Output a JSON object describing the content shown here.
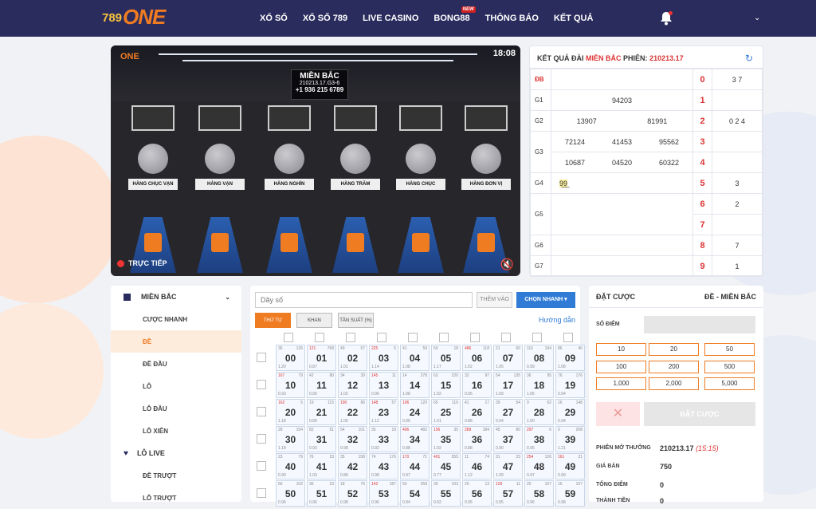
{
  "nav": {
    "logo_num": "789",
    "logo_text": "ONE",
    "items": [
      "XỔ SỐ",
      "XỔ SỐ 789",
      "LIVE CASINO",
      "BONG88",
      "THÔNG BÁO",
      "KẾT QUẢ"
    ],
    "new_badge": "NEW"
  },
  "video": {
    "logo": "ONE",
    "time": "18:08",
    "board_title": "MIỀN BẮC",
    "board_code": "210213.17.G3-6",
    "board_phone": "+1 936 215 6789",
    "signs": [
      "HÀNG CHỤC VẠN",
      "HÀNG VẠN",
      "HÀNG NGHÌN",
      "HÀNG TRĂM",
      "HÀNG CHỤC",
      "HÀNG ĐƠN VỊ"
    ],
    "live_label": "TRỰC TIẾP"
  },
  "results": {
    "title_prefix": "KẾT QUẢ ĐÀI",
    "region": "MIỀN BẮC",
    "session_label": "PHIÊN:",
    "session": "210213.17",
    "rows": [
      {
        "label": "ĐB",
        "nums": []
      },
      {
        "label": "G1",
        "nums": [
          "94203"
        ]
      },
      {
        "label": "G2",
        "nums": [
          "13907",
          "81991"
        ]
      },
      {
        "label": "G3",
        "nums": [
          "72124",
          "41453",
          "95562"
        ],
        "nums2": [
          "10687",
          "04520",
          "60322"
        ]
      },
      {
        "label": "G4",
        "nums": [
          "9̲9̲"
        ]
      },
      {
        "label": "G5",
        "nums": []
      },
      {
        "label": "G6",
        "nums": []
      },
      {
        "label": "G7",
        "nums": []
      }
    ],
    "heads": [
      "0",
      "1",
      "2",
      "3",
      "4",
      "5",
      "6",
      "7",
      "8",
      "9"
    ],
    "tails": [
      "3 7",
      "",
      "0 2 4",
      "",
      "",
      "3",
      "2",
      "",
      "7",
      "1"
    ]
  },
  "sidebar": {
    "group": "MIỀN BẮC",
    "items": [
      "CƯỢC NHANH",
      "ĐỀ",
      "ĐỀ ĐẦU",
      "LÔ",
      "LÔ ĐẦU",
      "LÔ XIÊN"
    ],
    "live_group": "LÔ LIVE",
    "live_items": [
      "ĐỀ TRƯỢT",
      "LÔ TRƯỢT"
    ]
  },
  "grid": {
    "search_placeholder": "Dãy số",
    "add_label": "THÊM VÀO",
    "quick_label": "CHỌN NHANH",
    "tabs": [
      "THỨ TỰ",
      "KHAN",
      "TẦN SUẤT (%)"
    ],
    "guide": "Hướng dẫn",
    "cells": [
      {
        "n": "00",
        "a": "36",
        "b": "126",
        "c": "1.20",
        "r": false
      },
      {
        "n": "01",
        "a": "121",
        "b": "768",
        "c": "0.87",
        "r": true
      },
      {
        "n": "02",
        "a": "49",
        "b": "57",
        "c": "1.01",
        "r": false
      },
      {
        "n": "03",
        "a": "225",
        "b": "5",
        "c": "1.14",
        "r": true
      },
      {
        "n": "04",
        "a": "41",
        "b": "59",
        "c": "1.08",
        "r": false
      },
      {
        "n": "05",
        "a": "59",
        "b": "18",
        "c": "1.17",
        "r": false
      },
      {
        "n": "06",
        "a": "486",
        "b": "118",
        "c": "1.02",
        "r": true
      },
      {
        "n": "07",
        "a": "21",
        "b": "60",
        "c": "1.05",
        "r": false
      },
      {
        "n": "08",
        "a": "116",
        "b": "194",
        "c": "0.99",
        "r": false
      },
      {
        "n": "09",
        "a": "86",
        "b": "40",
        "c": "1.08",
        "r": false
      },
      {
        "n": "10",
        "a": "167",
        "b": "79",
        "c": "0.93",
        "r": true
      },
      {
        "n": "11",
        "a": "42",
        "b": "80",
        "c": "0.90",
        "r": false
      },
      {
        "n": "12",
        "a": "34",
        "b": "39",
        "c": "1.02",
        "r": false
      },
      {
        "n": "13",
        "a": "145",
        "b": "11",
        "c": "0.96",
        "r": true
      },
      {
        "n": "14",
        "a": "14",
        "b": "278",
        "c": "1.08",
        "r": false
      },
      {
        "n": "15",
        "a": "63",
        "b": "220",
        "c": "1.02",
        "r": false
      },
      {
        "n": "16",
        "a": "32",
        "b": "97",
        "c": "0.95",
        "r": false
      },
      {
        "n": "17",
        "a": "54",
        "b": "135",
        "c": "1.09",
        "r": false
      },
      {
        "n": "18",
        "a": "36",
        "b": "95",
        "c": "1.05",
        "r": false
      },
      {
        "n": "19",
        "a": "76",
        "b": "176",
        "c": "0.94",
        "r": false
      },
      {
        "n": "20",
        "a": "162",
        "b": "5",
        "c": "1.18",
        "r": true
      },
      {
        "n": "21",
        "a": "19",
        "b": "115",
        "c": "0.89",
        "r": false
      },
      {
        "n": "22",
        "a": "190",
        "b": "86",
        "c": "1.05",
        "r": true
      },
      {
        "n": "23",
        "a": "148",
        "b": "57",
        "c": "1.12",
        "r": true
      },
      {
        "n": "24",
        "a": "106",
        "b": "120",
        "c": "0.96",
        "r": true
      },
      {
        "n": "25",
        "a": "65",
        "b": "116",
        "c": "1.01",
        "r": false
      },
      {
        "n": "26",
        "a": "41",
        "b": "17",
        "c": "0.88",
        "r": false
      },
      {
        "n": "27",
        "a": "39",
        "b": "54",
        "c": "0.94",
        "r": false
      },
      {
        "n": "28",
        "a": "9",
        "b": "62",
        "c": "1.00",
        "r": false
      },
      {
        "n": "29",
        "a": "16",
        "b": "148",
        "c": "0.94",
        "r": false
      },
      {
        "n": "30",
        "a": "28",
        "b": "154",
        "c": "1.18",
        "r": false
      },
      {
        "n": "31",
        "a": "82",
        "b": "51",
        "c": "0.93",
        "r": false
      },
      {
        "n": "32",
        "a": "54",
        "b": "101",
        "c": "0.98",
        "r": false
      },
      {
        "n": "33",
        "a": "35",
        "b": "10",
        "c": "0.92",
        "r": false
      },
      {
        "n": "34",
        "a": "406",
        "b": "482",
        "c": "0.98",
        "r": true
      },
      {
        "n": "35",
        "a": "156",
        "b": "35",
        "c": "1.02",
        "r": true
      },
      {
        "n": "36",
        "a": "289",
        "b": "184",
        "c": "0.88",
        "r": true
      },
      {
        "n": "37",
        "a": "45",
        "b": "80",
        "c": "0.90",
        "r": false
      },
      {
        "n": "38",
        "a": "297",
        "b": "6",
        "c": "0.95",
        "r": true
      },
      {
        "n": "39",
        "a": "0",
        "b": "208",
        "c": "1.21",
        "r": false
      },
      {
        "n": "40",
        "a": "23",
        "b": "79",
        "c": "0.90",
        "r": false
      },
      {
        "n": "41",
        "a": "76",
        "b": "23",
        "c": "1.03",
        "r": false
      },
      {
        "n": "42",
        "a": "35",
        "b": "158",
        "c": "0.86",
        "r": false
      },
      {
        "n": "43",
        "a": "74",
        "b": "176",
        "c": "0.98",
        "r": false
      },
      {
        "n": "44",
        "a": "170",
        "b": "71",
        "c": "0.97",
        "r": true
      },
      {
        "n": "45",
        "a": "401",
        "b": "555",
        "c": "0.77",
        "r": true
      },
      {
        "n": "46",
        "a": "11",
        "b": "74",
        "c": "1.12",
        "r": false
      },
      {
        "n": "47",
        "a": "31",
        "b": "23",
        "c": "1.09",
        "r": false
      },
      {
        "n": "48",
        "a": "254",
        "b": "126",
        "c": "0.97",
        "r": true
      },
      {
        "n": "49",
        "a": "161",
        "b": "21",
        "c": "0.99",
        "r": true
      },
      {
        "n": "50",
        "a": "56",
        "b": "102",
        "c": "0.96",
        "r": false
      },
      {
        "n": "51",
        "a": "36",
        "b": "23",
        "c": "0.96",
        "r": false
      },
      {
        "n": "52",
        "a": "18",
        "b": "76",
        "c": "0.98",
        "r": false
      },
      {
        "n": "53",
        "a": "142",
        "b": "187",
        "c": "0.96",
        "r": true
      },
      {
        "n": "54",
        "a": "50",
        "b": "258",
        "c": "0.94",
        "r": false
      },
      {
        "n": "55",
        "a": "30",
        "b": "103",
        "c": "0.92",
        "r": false
      },
      {
        "n": "56",
        "a": "20",
        "b": "13",
        "c": "0.95",
        "r": false
      },
      {
        "n": "57",
        "a": "129",
        "b": "11",
        "c": "0.95",
        "r": true
      },
      {
        "n": "58",
        "a": "20",
        "b": "107",
        "c": "0.96",
        "r": false
      },
      {
        "n": "59",
        "a": "16",
        "b": "107",
        "c": "0.98",
        "r": false
      }
    ]
  },
  "bet": {
    "title": "ĐẶT CƯỢC",
    "subtitle": "ĐỀ - MIỀN BẮC",
    "points_label": "SỐ ĐIỂM",
    "amounts": [
      "10",
      "20",
      "50",
      "100",
      "200",
      "500",
      "1,000",
      "2,000",
      "5,000"
    ],
    "cancel": "✕",
    "submit": "ĐẶT CƯỢC",
    "session_label": "PHIÊN MỞ THƯỞNG",
    "session_value": "210213.17",
    "session_time": "(15:15)",
    "price_label": "GIÁ BÁN",
    "price_value": "750",
    "total_label": "TỔNG ĐIỂM",
    "total_value": "0",
    "extra_label": "THÀNH TIỀN",
    "extra_value": "0"
  },
  "colors": {
    "nav_bg": "#2a2c5e",
    "accent": "#f07c22",
    "link": "#2f7bd6",
    "red": "#d33"
  }
}
